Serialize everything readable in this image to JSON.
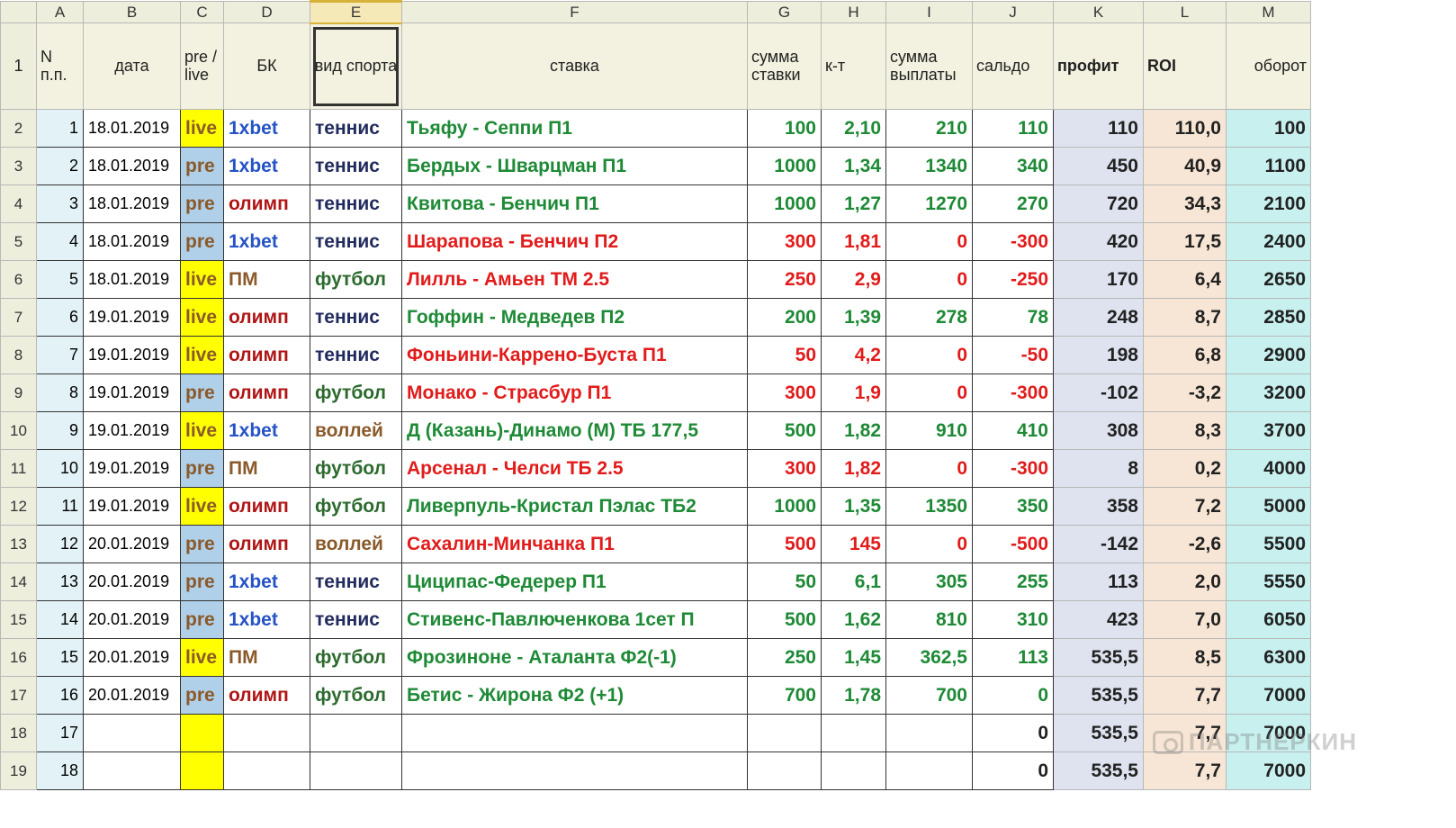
{
  "columns": [
    "",
    "A",
    "B",
    "C",
    "D",
    "E",
    "F",
    "G",
    "H",
    "I",
    "J",
    "K",
    "L",
    "M"
  ],
  "selected_col_index": 5,
  "headers": {
    "A": "N п.п.",
    "B": "дата",
    "C": "pre / live",
    "D": "БК",
    "E": "вид спорта",
    "F": "ставка",
    "G": "сумма ставки",
    "H": "к-т",
    "I": "сумма выплаты",
    "J": "сальдо",
    "K": "профит",
    "L": "ROI",
    "M": "оборот"
  },
  "rows": [
    {
      "n": 1,
      "date": "18.01.2019",
      "pl": "live",
      "bk": "1xbet",
      "sport": "теннис",
      "bet": "Тьяфу - Сеппи П1",
      "sum": 100,
      "k": "2,10",
      "pay": "210",
      "saldo": "110",
      "profit": "110",
      "roi": "110,0",
      "turn": "100",
      "win": true
    },
    {
      "n": 2,
      "date": "18.01.2019",
      "pl": "pre",
      "bk": "1xbet",
      "sport": "теннис",
      "bet": "Бердых - Шварцман П1",
      "sum": 1000,
      "k": "1,34",
      "pay": "1340",
      "saldo": "340",
      "profit": "450",
      "roi": "40,9",
      "turn": "1100",
      "win": true
    },
    {
      "n": 3,
      "date": "18.01.2019",
      "pl": "pre",
      "bk": "олимп",
      "sport": "теннис",
      "bet": "Квитова - Бенчич П1",
      "sum": 1000,
      "k": "1,27",
      "pay": "1270",
      "saldo": "270",
      "profit": "720",
      "roi": "34,3",
      "turn": "2100",
      "win": true
    },
    {
      "n": 4,
      "date": "18.01.2019",
      "pl": "pre",
      "bk": "1xbet",
      "sport": "теннис",
      "bet": "Шарапова - Бенчич П2",
      "sum": 300,
      "k": "1,81",
      "pay": "0",
      "saldo": "-300",
      "profit": "420",
      "roi": "17,5",
      "turn": "2400",
      "win": false
    },
    {
      "n": 5,
      "date": "18.01.2019",
      "pl": "live",
      "bk": "ПМ",
      "sport": "футбол",
      "bet": "Лилль - Амьен ТМ 2.5",
      "sum": 250,
      "k": "2,9",
      "pay": "0",
      "saldo": "-250",
      "profit": "170",
      "roi": "6,4",
      "turn": "2650",
      "win": false
    },
    {
      "n": 6,
      "date": "19.01.2019",
      "pl": "live",
      "bk": "олимп",
      "sport": "теннис",
      "bet": "Гоффин - Медведев П2",
      "sum": 200,
      "k": "1,39",
      "pay": "278",
      "saldo": "78",
      "profit": "248",
      "roi": "8,7",
      "turn": "2850",
      "win": true
    },
    {
      "n": 7,
      "date": "19.01.2019",
      "pl": "live",
      "bk": "олимп",
      "sport": "теннис",
      "bet": "Фоньини-Каррено-Буста П1",
      "sum": 50,
      "k": "4,2",
      "pay": "0",
      "saldo": "-50",
      "profit": "198",
      "roi": "6,8",
      "turn": "2900",
      "win": false
    },
    {
      "n": 8,
      "date": "19.01.2019",
      "pl": "pre",
      "bk": "олимп",
      "sport": "футбол",
      "bet": "Монако - Страсбур П1",
      "sum": 300,
      "k": "1,9",
      "pay": "0",
      "saldo": "-300",
      "profit": "-102",
      "roi": "-3,2",
      "turn": "3200",
      "win": false
    },
    {
      "n": 9,
      "date": "19.01.2019",
      "pl": "live",
      "bk": "1xbet",
      "sport": "воллей",
      "bet": "Д (Казань)-Динамо (М) ТБ 177,5",
      "sum": 500,
      "k": "1,82",
      "pay": "910",
      "saldo": "410",
      "profit": "308",
      "roi": "8,3",
      "turn": "3700",
      "win": true
    },
    {
      "n": 10,
      "date": "19.01.2019",
      "pl": "pre",
      "bk": "ПМ",
      "sport": "футбол",
      "bet": "Арсенал - Челси ТБ 2.5",
      "sum": 300,
      "k": "1,82",
      "pay": "0",
      "saldo": "-300",
      "profit": "8",
      "roi": "0,2",
      "turn": "4000",
      "win": false
    },
    {
      "n": 11,
      "date": "19.01.2019",
      "pl": "live",
      "bk": "олимп",
      "sport": "футбол",
      "bet": "Ливерпуль-Кристал Пэлас ТБ2",
      "sum": 1000,
      "k": "1,35",
      "pay": "1350",
      "saldo": "350",
      "profit": "358",
      "roi": "7,2",
      "turn": "5000",
      "win": true
    },
    {
      "n": 12,
      "date": "20.01.2019",
      "pl": "pre",
      "bk": "олимп",
      "sport": "воллей",
      "bet": "Сахалин-Минчанка П1",
      "sum": 500,
      "k": "145",
      "pay": "0",
      "saldo": "-500",
      "profit": "-142",
      "roi": "-2,6",
      "turn": "5500",
      "win": false
    },
    {
      "n": 13,
      "date": "20.01.2019",
      "pl": "pre",
      "bk": "1xbet",
      "sport": "теннис",
      "bet": "Циципас-Федерер П1",
      "sum": 50,
      "k": "6,1",
      "pay": "305",
      "saldo": "255",
      "profit": "113",
      "roi": "2,0",
      "turn": "5550",
      "win": true
    },
    {
      "n": 14,
      "date": "20.01.2019",
      "pl": "pre",
      "bk": "1xbet",
      "sport": "теннис",
      "bet": "Стивенс-Павлюченкова 1сет П",
      "sum": 500,
      "k": "1,62",
      "pay": "810",
      "saldo": "310",
      "profit": "423",
      "roi": "7,0",
      "turn": "6050",
      "win": true
    },
    {
      "n": 15,
      "date": "20.01.2019",
      "pl": "live",
      "bk": "ПМ",
      "sport": "футбол",
      "bet": "Фрозиноне - Аталанта Ф2(-1)",
      "sum": 250,
      "k": "1,45",
      "pay": "362,5",
      "saldo": "113",
      "profit": "535,5",
      "roi": "8,5",
      "turn": "6300",
      "win": true
    },
    {
      "n": 16,
      "date": "20.01.2019",
      "pl": "pre",
      "bk": "олимп",
      "sport": "футбол",
      "bet": "Бетис - Жирона Ф2 (+1)",
      "sum": 700,
      "k": "1,78",
      "pay": "700",
      "saldo": "0",
      "profit": "535,5",
      "roi": "7,7",
      "turn": "7000",
      "win": true
    }
  ],
  "tail_rows": [
    {
      "n": 17,
      "saldo": "0",
      "profit": "535,5",
      "roi": "7,7",
      "turn": "7000"
    },
    {
      "n": 18,
      "saldo": "0",
      "profit": "535,5",
      "roi": "7,7",
      "turn": "7000"
    }
  ],
  "watermark": "ПАРТНЕРКИН"
}
